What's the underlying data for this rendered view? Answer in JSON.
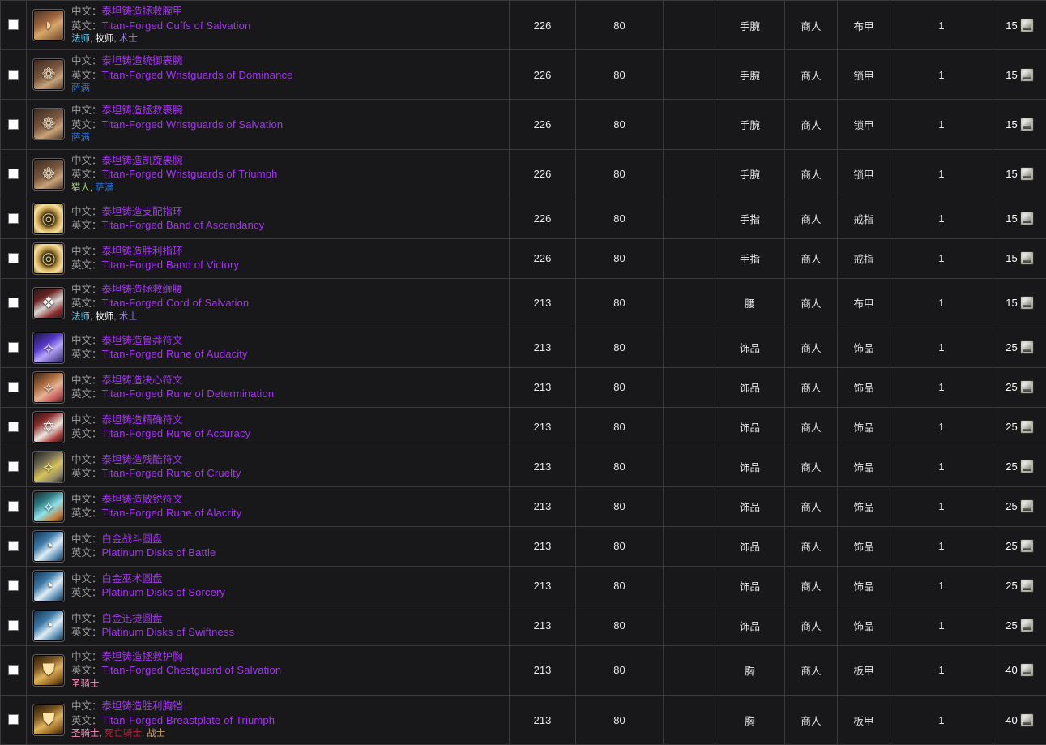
{
  "page": {
    "title": "Titan-Forged / Platinum Item List",
    "labels": {
      "zh": "中文：",
      "en": "英文："
    },
    "currency_icon": "emblem-token-icon",
    "class_separator": ", "
  },
  "colors": {
    "background": "#18181a",
    "grid_line": "#3a3a3c",
    "epic_item": "#a335ee",
    "label_gray": "#9a9a9a",
    "value_text": "#e8e8e8",
    "mage": "#69ccf0",
    "priest": "#ffffff",
    "warlock": "#9482c9",
    "shaman": "#2a6fd6",
    "hunter": "#abd473",
    "paladin": "#f58cba",
    "deathknight": "#c41f3b",
    "warrior": "#c79c6e"
  },
  "columns": [
    {
      "key": "check",
      "label": ""
    },
    {
      "key": "name",
      "label": ""
    },
    {
      "key": "ilvl",
      "label": ""
    },
    {
      "key": "rlvl",
      "label": ""
    },
    {
      "key": "extra",
      "label": ""
    },
    {
      "key": "slot",
      "label": ""
    },
    {
      "key": "source",
      "label": ""
    },
    {
      "key": "armor",
      "label": ""
    },
    {
      "key": "count",
      "label": ""
    },
    {
      "key": "cost",
      "label": ""
    }
  ],
  "rows": [
    {
      "checked": false,
      "icon": {
        "name": "bracer-cloth-icon",
        "glyph": "◗",
        "bg": "linear-gradient(150deg,#4a3226 0%,#a0693f 40%,#d9a86b 58%,#6b452c 100%)",
        "fg": "#f0d2a4"
      },
      "name_zh": "泰坦铸造拯救腕甲",
      "name_en": "Titan-Forged Cuffs of Salvation",
      "classes": [
        {
          "label": "法师",
          "cls": "cls-mage"
        },
        {
          "label": "牧师",
          "cls": "cls-priest"
        },
        {
          "label": "术士",
          "cls": "cls-warlock"
        }
      ],
      "ilvl": "226",
      "rlvl": "80",
      "extra": "",
      "slot": "手腕",
      "source": "商人",
      "armor": "布甲",
      "count": "1",
      "cost": "15"
    },
    {
      "checked": false,
      "icon": {
        "name": "bracer-mail-icon",
        "glyph": "❁",
        "bg": "linear-gradient(150deg,#3b2a22 0%,#7a5840 45%,#c9a479 70%,#4d382b 100%)",
        "fg": "#efdcc0"
      },
      "name_zh": "泰坦铸造统御裹腕",
      "name_en": "Titan-Forged Wristguards of Dominance",
      "classes": [
        {
          "label": "萨满",
          "cls": "cls-shaman"
        }
      ],
      "ilvl": "226",
      "rlvl": "80",
      "extra": "",
      "slot": "手腕",
      "source": "商人",
      "armor": "锁甲",
      "count": "1",
      "cost": "15"
    },
    {
      "checked": false,
      "icon": {
        "name": "bracer-mail-icon",
        "glyph": "❁",
        "bg": "linear-gradient(150deg,#3b2a22 0%,#7a5840 45%,#c9a479 70%,#4d382b 100%)",
        "fg": "#efdcc0"
      },
      "name_zh": "泰坦铸造拯救裹腕",
      "name_en": "Titan-Forged Wristguards of Salvation",
      "classes": [
        {
          "label": "萨满",
          "cls": "cls-shaman"
        }
      ],
      "ilvl": "226",
      "rlvl": "80",
      "extra": "",
      "slot": "手腕",
      "source": "商人",
      "armor": "锁甲",
      "count": "1",
      "cost": "15"
    },
    {
      "checked": false,
      "icon": {
        "name": "bracer-mail-icon",
        "glyph": "❁",
        "bg": "linear-gradient(150deg,#3b2a22 0%,#7a5840 45%,#c9a479 70%,#4d382b 100%)",
        "fg": "#efdcc0"
      },
      "name_zh": "泰坦铸造凯旋裹腕",
      "name_en": "Titan-Forged Wristguards of Triumph",
      "classes": [
        {
          "label": "猎人",
          "cls": "cls-hunter"
        },
        {
          "label": "萨满",
          "cls": "cls-shaman"
        }
      ],
      "ilvl": "226",
      "rlvl": "80",
      "extra": "",
      "slot": "手腕",
      "source": "商人",
      "armor": "锁甲",
      "count": "1",
      "cost": "15"
    },
    {
      "checked": false,
      "icon": {
        "name": "ring-icon",
        "glyph": "◎",
        "bg": "radial-gradient(circle at 50% 50%, #2b2b2b 0%, #4a3a1c 28%, #d9b25c 55%, #f3e0a2 72%, #8a6a28 100%)",
        "fg": "#d8c070"
      },
      "name_zh": "泰坦铸造支配指环",
      "name_en": "Titan-Forged Band of Ascendancy",
      "classes": [],
      "ilvl": "226",
      "rlvl": "80",
      "extra": "",
      "slot": "手指",
      "source": "商人",
      "armor": "戒指",
      "count": "1",
      "cost": "15"
    },
    {
      "checked": false,
      "icon": {
        "name": "ring-icon",
        "glyph": "◎",
        "bg": "radial-gradient(circle at 50% 50%, #2b2b2b 0%, #4a3a1c 28%, #d9b25c 55%, #f3e0a2 72%, #8a6a28 100%)",
        "fg": "#d8c070"
      },
      "name_zh": "泰坦铸造胜利指环",
      "name_en": "Titan-Forged Band of Victory",
      "classes": [],
      "ilvl": "226",
      "rlvl": "80",
      "extra": "",
      "slot": "手指",
      "source": "商人",
      "armor": "戒指",
      "count": "1",
      "cost": "15"
    },
    {
      "checked": false,
      "icon": {
        "name": "belt-cloth-icon",
        "glyph": "❖",
        "bg": "linear-gradient(150deg,#1d1d1f 0%,#6a2222 30%,#d8d8d4 55%,#8a2a2a 80%,#272729 100%)",
        "fg": "#f2f2ee"
      },
      "name_zh": "泰坦铸造拯救缠腰",
      "name_en": "Titan-Forged Cord of Salvation",
      "classes": [
        {
          "label": "法师",
          "cls": "cls-mage"
        },
        {
          "label": "牧师",
          "cls": "cls-priest"
        },
        {
          "label": "术士",
          "cls": "cls-warlock"
        }
      ],
      "ilvl": "213",
      "rlvl": "80",
      "extra": "",
      "slot": "腰",
      "source": "商人",
      "armor": "布甲",
      "count": "1",
      "cost": "15"
    },
    {
      "checked": false,
      "icon": {
        "name": "rune-audacity-icon",
        "glyph": "⟡",
        "bg": "linear-gradient(145deg,#1b1440 0%,#5639c8 38%,#b9a6ff 60%,#2a1f68 100%)",
        "fg": "#e4dcff"
      },
      "name_zh": "泰坦铸造鲁莽符文",
      "name_en": "Titan-Forged Rune of Audacity",
      "classes": [],
      "ilvl": "213",
      "rlvl": "80",
      "extra": "",
      "slot": "饰品",
      "source": "商人",
      "armor": "饰品",
      "count": "1",
      "cost": "25"
    },
    {
      "checked": false,
      "icon": {
        "name": "rune-determination-icon",
        "glyph": "⟡",
        "bg": "linear-gradient(145deg,#3a2418 0%,#a86a3c 35%,#e8b394 58%,#c3545a 82%,#3d2018 100%)",
        "fg": "#ffd9cd"
      },
      "name_zh": "泰坦铸造决心符文",
      "name_en": "Titan-Forged Rune of Determination",
      "classes": [],
      "ilvl": "213",
      "rlvl": "80",
      "extra": "",
      "slot": "饰品",
      "source": "商人",
      "armor": "饰品",
      "count": "1",
      "cost": "25"
    },
    {
      "checked": false,
      "icon": {
        "name": "rune-accuracy-icon",
        "glyph": "✡",
        "bg": "linear-gradient(145deg,#2a1416 0%,#8a2c2c 30%,#efe6df 58%,#a63a3a 82%,#2e1518 100%)",
        "fg": "#ffe8e8"
      },
      "name_zh": "泰坦铸造精确符文",
      "name_en": "Titan-Forged Rune of Accuracy",
      "classes": [],
      "ilvl": "213",
      "rlvl": "80",
      "extra": "",
      "slot": "饰品",
      "source": "商人",
      "armor": "饰品",
      "count": "1",
      "cost": "25"
    },
    {
      "checked": false,
      "icon": {
        "name": "rune-cruelty-icon",
        "glyph": "⟡",
        "bg": "linear-gradient(145deg,#23221e 0%,#6f6a52 32%,#d8c45a 58%,#8e8766 82%,#24231f 100%)",
        "fg": "#ffee9a"
      },
      "name_zh": "泰坦铸造残酷符文",
      "name_en": "Titan-Forged Rune of Cruelty",
      "classes": [],
      "ilvl": "213",
      "rlvl": "80",
      "extra": "",
      "slot": "饰品",
      "source": "商人",
      "armor": "饰品",
      "count": "1",
      "cost": "25"
    },
    {
      "checked": false,
      "icon": {
        "name": "rune-alacrity-icon",
        "glyph": "⟡",
        "bg": "linear-gradient(145deg,#1d2a2b 0%,#2f7d84 32%,#8fe3ea 56%,#c5772f 84%,#1f2a2b 100%)",
        "fg": "#ccf6fa"
      },
      "name_zh": "泰坦铸造敏锐符文",
      "name_en": "Titan-Forged Rune of Alacrity",
      "classes": [],
      "ilvl": "213",
      "rlvl": "80",
      "extra": "",
      "slot": "饰品",
      "source": "商人",
      "armor": "饰品",
      "count": "1",
      "cost": "25"
    },
    {
      "checked": false,
      "icon": {
        "name": "platinum-disk-icon",
        "glyph": "◔",
        "bg": "linear-gradient(140deg,#16324e 0%,#3f7ba8 35%,#dfeef8 58%,#5f90b5 80%,#152c45 100%)",
        "fg": "#ffffff"
      },
      "name_zh": "白金战斗圆盘",
      "name_en": "Platinum Disks of Battle",
      "classes": [],
      "ilvl": "213",
      "rlvl": "80",
      "extra": "",
      "slot": "饰品",
      "source": "商人",
      "armor": "饰品",
      "count": "1",
      "cost": "25"
    },
    {
      "checked": false,
      "icon": {
        "name": "platinum-disk-icon",
        "glyph": "◔",
        "bg": "linear-gradient(140deg,#16324e 0%,#3f7ba8 35%,#dfeef8 58%,#5f90b5 80%,#152c45 100%)",
        "fg": "#ffffff"
      },
      "name_zh": "白金巫术圆盘",
      "name_en": "Platinum Disks of Sorcery",
      "classes": [],
      "ilvl": "213",
      "rlvl": "80",
      "extra": "",
      "slot": "饰品",
      "source": "商人",
      "armor": "饰品",
      "count": "1",
      "cost": "25"
    },
    {
      "checked": false,
      "icon": {
        "name": "platinum-disk-icon",
        "glyph": "◔",
        "bg": "linear-gradient(140deg,#16324e 0%,#3f7ba8 35%,#dfeef8 58%,#5f90b5 80%,#152c45 100%)",
        "fg": "#ffffff"
      },
      "name_zh": "白金迅捷圆盘",
      "name_en": "Platinum Disks of Swiftness",
      "classes": [],
      "ilvl": "213",
      "rlvl": "80",
      "extra": "",
      "slot": "饰品",
      "source": "商人",
      "armor": "饰品",
      "count": "1",
      "cost": "25"
    },
    {
      "checked": false,
      "icon": {
        "name": "chest-plate-icon",
        "glyph": "⛊",
        "bg": "linear-gradient(150deg,#2a1b0e 0%,#7a5520 32%,#e0b45c 56%,#9a6c28 78%,#241708 100%)",
        "fg": "#ffe3a8"
      },
      "name_zh": "泰坦铸造拯救护胸",
      "name_en": "Titan-Forged Chestguard of Salvation",
      "classes": [
        {
          "label": "圣骑士",
          "cls": "cls-paladin"
        }
      ],
      "ilvl": "213",
      "rlvl": "80",
      "extra": "",
      "slot": "胸",
      "source": "商人",
      "armor": "板甲",
      "count": "1",
      "cost": "40"
    },
    {
      "checked": false,
      "icon": {
        "name": "chest-plate-icon",
        "glyph": "⛊",
        "bg": "linear-gradient(150deg,#2a1b0e 0%,#7a5520 32%,#e0b45c 56%,#9a6c28 78%,#241708 100%)",
        "fg": "#ffe3a8"
      },
      "name_zh": "泰坦铸造胜利胸铠",
      "name_en": "Titan-Forged Breastplate of Triumph",
      "classes": [
        {
          "label": "圣骑士",
          "cls": "cls-paladin"
        },
        {
          "label": "死亡骑士",
          "cls": "cls-deathknight"
        },
        {
          "label": "战士",
          "cls": "cls-warrior"
        }
      ],
      "ilvl": "213",
      "rlvl": "80",
      "extra": "",
      "slot": "胸",
      "source": "商人",
      "armor": "板甲",
      "count": "1",
      "cost": "40"
    }
  ]
}
